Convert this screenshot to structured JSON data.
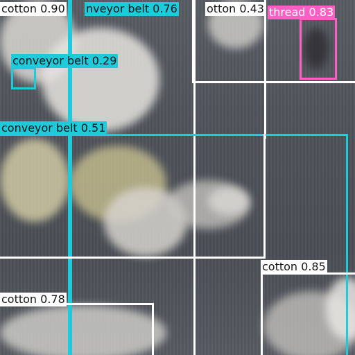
{
  "image": {
    "background_color": "#4a4e55",
    "class_colors": {
      "cotton": "#ffffff",
      "conveyor belt": "#1fcadb",
      "thread": "#ff5fc4"
    }
  },
  "detections": {
    "cotton_top_left": {
      "class": "cotton",
      "confidence": "0.90",
      "label": "cotton 0.90"
    },
    "conveyor_belt_top": {
      "class": "conveyor belt",
      "confidence": "0.76",
      "label": "nveyor belt 0.76"
    },
    "cotton_top_mid": {
      "class": "cotton",
      "confidence": "0.43",
      "label": "otton 0.43"
    },
    "thread": {
      "class": "thread",
      "confidence": "0.83",
      "label": "thread 0.83"
    },
    "conveyor_belt_small": {
      "class": "conveyor belt",
      "confidence": "0.29",
      "label": "conveyor belt 0.29"
    },
    "conveyor_belt_mid": {
      "class": "conveyor belt",
      "confidence": "0.51",
      "label": "conveyor belt 0.51"
    },
    "cotton_bottom_right": {
      "class": "cotton",
      "confidence": "0.85",
      "label": "cotton 0.85"
    },
    "cotton_bottom_left": {
      "class": "cotton",
      "confidence": "0.78",
      "label": "cotton 0.78"
    }
  }
}
